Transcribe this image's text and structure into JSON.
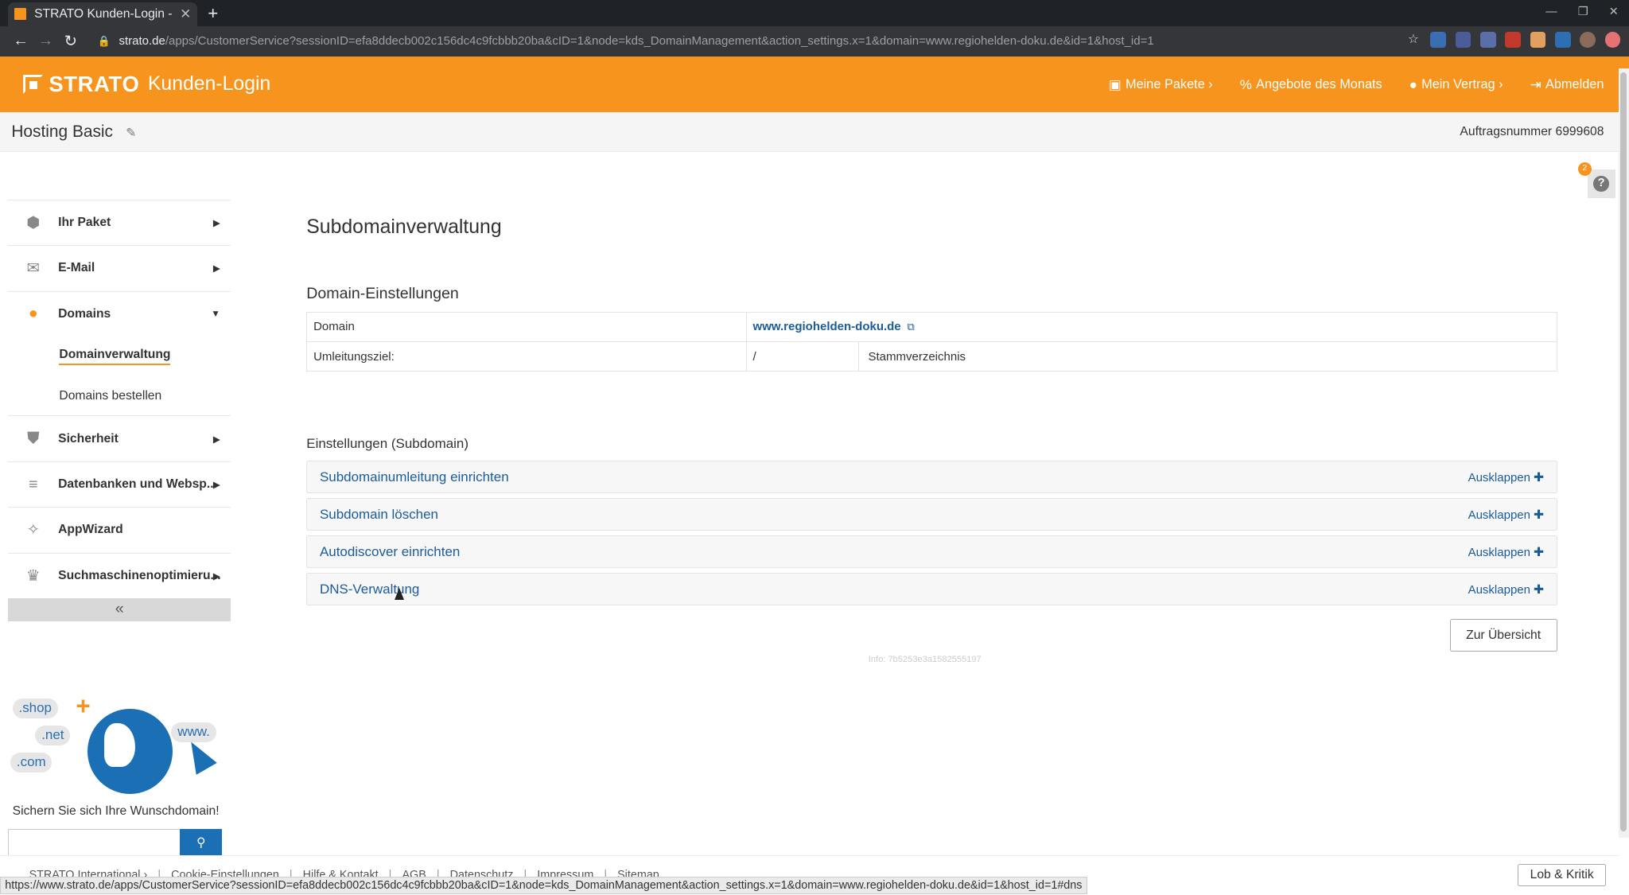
{
  "browser": {
    "tab_title": "STRATO Kunden-Login - D",
    "tab_close": "✕",
    "new_tab": "+",
    "url_host": "strato.de",
    "url_rest": "/apps/CustomerService?sessionID=efa8ddecb002c156dc4c9fcbbb20ba&cID=1&node=kds_DomainManagement&action_settings.x=1&domain=www.regiohelden-doku.de&id=1&host_id=1",
    "status_url": "https://www.strato.de/apps/CustomerService?sessionID=efa8ddecb002c156dc4c9fcbbb20ba&cID=1&node=kds_DomainManagement&action_settings.x=1&domain=www.regiohelden-doku.de&id=1&host_id=1#dns"
  },
  "header": {
    "brand": "STRATO",
    "subtitle": "Kunden-Login",
    "nav": [
      {
        "label": "Meine Pakete ›",
        "icon": "box-icon"
      },
      {
        "label": "Angebote des Monats",
        "icon": "percent-icon"
      },
      {
        "label": "Mein Vertrag ›",
        "icon": "user-icon"
      },
      {
        "label": "Abmelden",
        "icon": "logout-icon"
      }
    ]
  },
  "subheader": {
    "package_name": "Hosting Basic",
    "order_number": "Auftragsnummer 6999608"
  },
  "sidebar": {
    "items": [
      {
        "label": "Ihr Paket"
      },
      {
        "label": "E-Mail"
      },
      {
        "label": "Domains"
      },
      {
        "label": "Sicherheit"
      },
      {
        "label": "Datenbanken und Websp..."
      },
      {
        "label": "AppWizard"
      },
      {
        "label": "Suchmaschinenoptimieru..."
      }
    ],
    "sub_items": [
      {
        "label": "Domainverwaltung"
      },
      {
        "label": "Domains bestellen"
      }
    ],
    "collapse": "«"
  },
  "promo": {
    "bubbles": [
      ".shop",
      ".net",
      ".com",
      "www."
    ],
    "text": "Sichern Sie sich Ihre Wunschdomain!"
  },
  "main": {
    "title": "Subdomainverwaltung",
    "settings_title": "Domain-Einstellungen",
    "rows": {
      "domain_label": "Domain",
      "domain_value": "www.regiohelden-doku.de",
      "redirect_label": "Umleitungsziel:",
      "redirect_path": "/",
      "redirect_target": "Stammverzeichnis"
    },
    "subdomain_title": "Einstellungen (Subdomain)",
    "accordions": [
      {
        "title": "Subdomainumleitung einrichten",
        "action": "Ausklappen"
      },
      {
        "title": "Subdomain löschen",
        "action": "Ausklappen"
      },
      {
        "title": "Autodiscover einrichten",
        "action": "Ausklappen"
      },
      {
        "title": "DNS-Verwaltung",
        "action": "Ausklappen"
      }
    ],
    "overview_button": "Zur Übersicht",
    "info": "Info: 7b5253e3a1582555197"
  },
  "help_badge": "2",
  "footer": {
    "links": [
      "STRATO International ›",
      "Cookie-Einstellungen",
      "Hilfe & Kontakt",
      "AGB",
      "Datenschutz",
      "Impressum",
      "Sitemap"
    ],
    "feedback": "Lob & Kritik"
  }
}
